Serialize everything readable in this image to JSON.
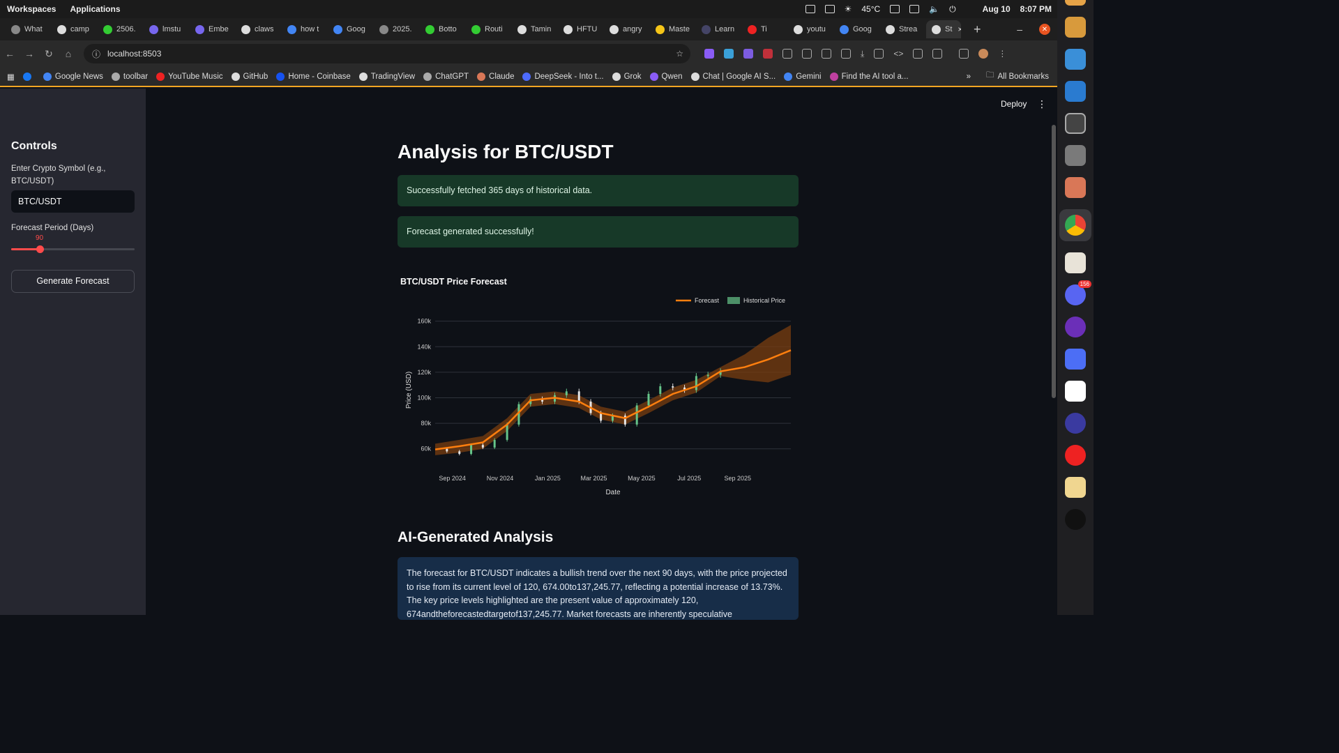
{
  "os": {
    "workspaces": "Workspaces",
    "applications": "Applications",
    "temp": "45°C",
    "date": "Aug 10",
    "time": "8:07 PM"
  },
  "tabs": [
    {
      "label": "What",
      "color": "#888"
    },
    {
      "label": "camp",
      "color": "#ddd"
    },
    {
      "label": "2506.",
      "color": "#3c3"
    },
    {
      "label": "lmstu",
      "color": "#7766ee"
    },
    {
      "label": "Embe",
      "color": "#7766ee"
    },
    {
      "label": "claws",
      "color": "#ddd"
    },
    {
      "label": "how t",
      "color": "#4285f4"
    },
    {
      "label": "Goog",
      "color": "#4285f4"
    },
    {
      "label": "2025.",
      "color": "#888"
    },
    {
      "label": "Botto",
      "color": "#3c3"
    },
    {
      "label": "Routi",
      "color": "#3c3"
    },
    {
      "label": "Tamin",
      "color": "#ddd"
    },
    {
      "label": "HFTU",
      "color": "#ddd"
    },
    {
      "label": "angry",
      "color": "#ddd"
    },
    {
      "label": "Maste",
      "color": "#f5c518"
    },
    {
      "label": "Learn",
      "color": "#446"
    },
    {
      "label": "Ti",
      "color": "#e22"
    },
    {
      "label": "youtu",
      "color": "#ddd"
    },
    {
      "label": "Goog",
      "color": "#4285f4"
    },
    {
      "label": "Strea",
      "color": "#ddd"
    }
  ],
  "active_tab": {
    "label": "St",
    "close": "×"
  },
  "new_tab": "+",
  "address": {
    "url": "localhost:8503"
  },
  "bookmarks": [
    {
      "label": "",
      "color": "#1877f2"
    },
    {
      "label": "Google News",
      "color": "#4285f4"
    },
    {
      "label": "toolbar",
      "color": "#aaa"
    },
    {
      "label": "YouTube Music",
      "color": "#e22"
    },
    {
      "label": "GitHub",
      "color": "#ddd"
    },
    {
      "label": "Home - Coinbase",
      "color": "#1652f0"
    },
    {
      "label": "TradingView",
      "color": "#ddd"
    },
    {
      "label": "ChatGPT",
      "color": "#aaa"
    },
    {
      "label": "Claude",
      "color": "#d97757"
    },
    {
      "label": "DeepSeek - Into t...",
      "color": "#4d6bfe"
    },
    {
      "label": "Grok",
      "color": "#ddd"
    },
    {
      "label": "Qwen",
      "color": "#8a5cf6"
    },
    {
      "label": "Chat | Google AI S...",
      "color": "#ddd"
    },
    {
      "label": "Gemini",
      "color": "#4285f4"
    },
    {
      "label": "Find the AI tool a...",
      "color": "#c040a0"
    }
  ],
  "bookmarks_more": "»",
  "all_bookmarks": "All Bookmarks",
  "dock_badge": "156",
  "sidebar": {
    "title": "Controls",
    "symbol_label": "Enter Crypto Symbol (e.g., BTC/USDT)",
    "symbol_value": "BTC/USDT",
    "period_label": "Forecast Period (Days)",
    "period_value": "90",
    "period_fraction": 0.23,
    "button": "Generate Forecast"
  },
  "header": {
    "deploy": "Deploy",
    "menu": "⋮"
  },
  "main": {
    "title": "Analysis for BTC/USDT",
    "alert1": "Successfully fetched 365 days of historical data.",
    "alert2": "Forecast generated successfully!",
    "ai_title": "AI-Generated Analysis",
    "ai_text": "The forecast for BTC/USDT indicates a bullish trend over the next 90 days, with the price projected to rise from its current level of 120, 674.00to137,245.77, reflecting a potential increase of 13.73%. The key price levels highlighted are the present value of approximately 120, 674andtheforecastedtargetof137,245.77. Market forecasts are inherently speculative"
  },
  "chart_data": {
    "type": "line",
    "title": "BTC/USDT Price Forecast",
    "xlabel": "Date",
    "ylabel": "Price (USD)",
    "x_ticks": [
      "Sep 2024",
      "Nov 2024",
      "Jan 2025",
      "Mar 2025",
      "May 2025",
      "Jul 2025",
      "Sep 2025"
    ],
    "y_ticks": [
      "60k",
      "80k",
      "100k",
      "120k",
      "140k",
      "160k"
    ],
    "ylim": [
      50000,
      162000
    ],
    "legend": [
      "Forecast",
      "Historical Price"
    ],
    "legend_position": "top-right",
    "colors": {
      "forecast": "#ff7f0e",
      "band": "#7a3d10",
      "up": "#66c58a",
      "down": "#e5e5e5"
    },
    "forecast": {
      "x": [
        "2024-08-10",
        "2024-09-10",
        "2024-10-10",
        "2024-11-10",
        "2024-12-10",
        "2025-01-10",
        "2025-02-10",
        "2025-03-10",
        "2025-04-10",
        "2025-05-10",
        "2025-06-10",
        "2025-07-10",
        "2025-08-10",
        "2025-09-10",
        "2025-10-10",
        "2025-11-08"
      ],
      "y": [
        59500,
        62000,
        65000,
        79000,
        98000,
        100000,
        97000,
        88000,
        84000,
        93000,
        103000,
        109000,
        120674,
        124000,
        130000,
        137246
      ],
      "lower": [
        55000,
        57000,
        60000,
        74000,
        93000,
        95000,
        92000,
        83000,
        79000,
        88000,
        98000,
        104000,
        117000,
        114000,
        112000,
        118000
      ],
      "upper": [
        64000,
        67000,
        70000,
        84000,
        103000,
        105000,
        102000,
        93000,
        89000,
        98000,
        108000,
        114000,
        124000,
        134000,
        147000,
        157000
      ]
    },
    "historical": {
      "x": [
        "2024-08-10",
        "2024-08-25",
        "2024-09-10",
        "2024-09-25",
        "2024-10-10",
        "2024-10-25",
        "2024-11-10",
        "2024-11-25",
        "2024-12-10",
        "2024-12-25",
        "2025-01-10",
        "2025-01-25",
        "2025-02-10",
        "2025-02-25",
        "2025-03-10",
        "2025-03-25",
        "2025-04-10",
        "2025-04-25",
        "2025-05-10",
        "2025-05-25",
        "2025-06-10",
        "2025-06-25",
        "2025-07-10",
        "2025-07-25",
        "2025-08-10"
      ],
      "y": [
        60000,
        58000,
        56000,
        63000,
        61000,
        67000,
        79000,
        95000,
        99000,
        97000,
        102000,
        105000,
        97000,
        88000,
        82000,
        86000,
        79000,
        94000,
        103000,
        109000,
        108000,
        106000,
        117000,
        118000,
        120674
      ]
    }
  }
}
